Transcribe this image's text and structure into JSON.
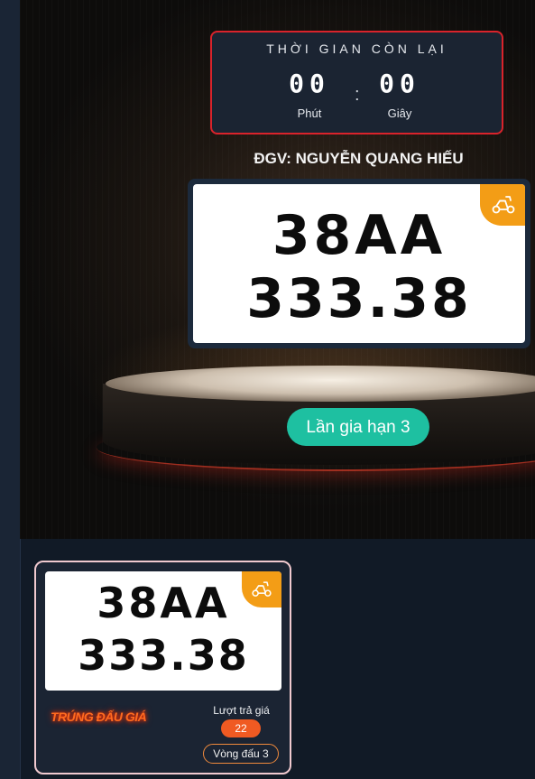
{
  "timer": {
    "title": "THỜI GIAN CÒN LẠI",
    "minutes": "00",
    "seconds": "00",
    "separator": ":",
    "minutes_label": "Phút",
    "seconds_label": "Giây"
  },
  "auctioneer": "ĐGV: NGUYỄN QUANG HIẾU",
  "plate": {
    "line1": "38AA",
    "line2": "333.38",
    "vehicle_icon": "scooter-icon"
  },
  "extension_button_label": "Lần gia hạn 3",
  "result": {
    "plate_line1": "38AA",
    "plate_line2": "333.38",
    "vehicle_icon": "scooter-icon",
    "winner_stamp": "TRÚNG ĐẤU GIÁ",
    "bids_label": "Lượt trả giá",
    "bids_count": "22",
    "round_label": "Vòng đấu 3"
  },
  "colors": {
    "accent_teal": "#1ec0a1",
    "timer_border": "#d9232b",
    "badge_orange": "#f39d16",
    "bids_orange": "#f05a22"
  }
}
